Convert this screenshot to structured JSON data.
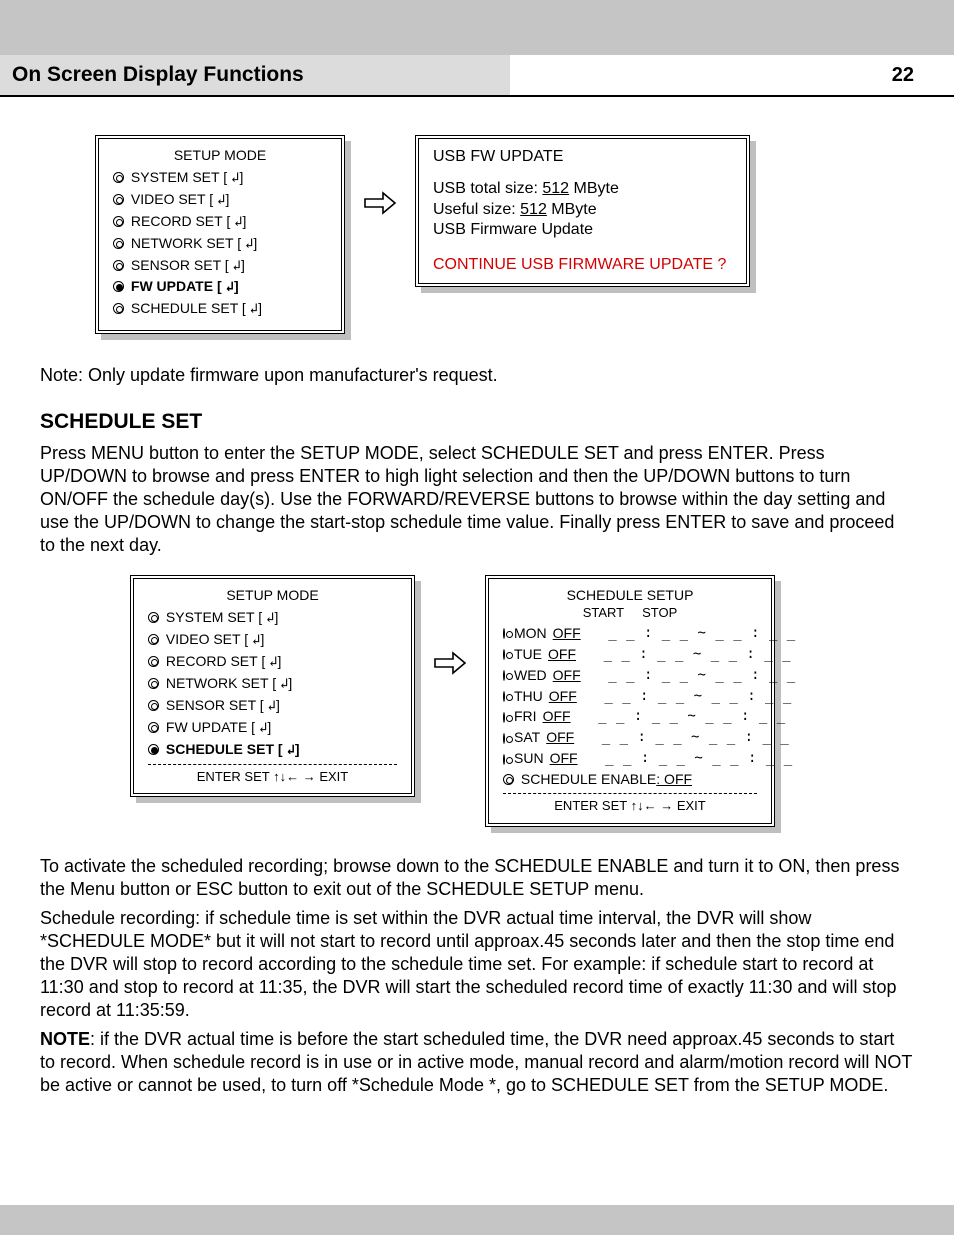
{
  "header": {
    "title": "On Screen Display Functions",
    "page": "22"
  },
  "setupMode1": {
    "title": "SETUP MODE",
    "items": [
      {
        "label": "SYSTEM SET",
        "bold": false
      },
      {
        "label": "VIDEO SET",
        "bold": false
      },
      {
        "label": "RECORD SET",
        "bold": false
      },
      {
        "label": "NETWORK SET",
        "bold": false
      },
      {
        "label": "SENSOR SET",
        "bold": false
      },
      {
        "label": "FW UPDATE",
        "bold": true
      },
      {
        "label": "SCHEDULE SET",
        "bold": false
      }
    ]
  },
  "usbBox": {
    "title": "USB FW UPDATE",
    "line1a": "USB total size: ",
    "line1b": "512",
    "line1c": " MByte",
    "line2a": "Useful size: ",
    "line2b": "512",
    "line2c": " MByte",
    "line3": "USB Firmware Update",
    "prompt": "CONTINUE USB FIRMWARE UPDATE ?"
  },
  "note1": "Note: Only update firmware upon manufacturer's request.",
  "scheduleHeading": "SCHEDULE SET",
  "schedulePara": "Press MENU button to enter the SETUP MODE, select SCHEDULE SET and press ENTER. Press UP/DOWN to browse and press ENTER to high light selection and then the UP/DOWN buttons to turn ON/OFF the schedule day(s). Use the FORWARD/REVERSE buttons to browse within the day setting and use the UP/DOWN to change the start-stop schedule time value. Finally press ENTER to save and proceed to the next day.",
  "setupMode2": {
    "title": "SETUP MODE",
    "items": [
      {
        "label": "SYSTEM SET",
        "bold": false
      },
      {
        "label": "VIDEO SET",
        "bold": false
      },
      {
        "label": "RECORD SET",
        "bold": false
      },
      {
        "label": "NETWORK SET",
        "bold": false
      },
      {
        "label": "SENSOR SET",
        "bold": false
      },
      {
        "label": "FW UPDATE",
        "bold": false
      },
      {
        "label": "SCHEDULE SET",
        "bold": true
      }
    ],
    "footer": "ENTER SET ↑↓← → EXIT"
  },
  "scheduleBox": {
    "title": "SCHEDULE SETUP",
    "colStart": "START",
    "colStop": "STOP",
    "days": [
      {
        "day": "MON",
        "state": "OFF"
      },
      {
        "day": "TUE",
        "state": "OFF"
      },
      {
        "day": "WED",
        "state": "OFF"
      },
      {
        "day": "THU",
        "state": "OFF"
      },
      {
        "day": "FRI",
        "state": "OFF"
      },
      {
        "day": "SAT",
        "state": "OFF"
      },
      {
        "day": "SUN",
        "state": "OFF"
      }
    ],
    "timeTemplate": "_ _ : _ _ ~ _ _ : _ _",
    "enableLabel": "SCHEDULE ENABLE",
    "enableValue": ": OFF",
    "footer": "ENTER SET ↑↓← → EXIT"
  },
  "para2": "To activate the scheduled recording; browse down to the SCHEDULE ENABLE and turn it to ON, then press the Menu button or ESC button to exit out of the SCHEDULE SETUP menu.",
  "para3": "Schedule recording: if schedule time is set within the DVR actual time interval, the DVR will show *SCHEDULE MODE* but it will not start to record until approax.45 seconds later and then the stop time end the DVR will stop to record according to the schedule time set. For example: if schedule start to record at 11:30 and stop to record at 11:35, the DVR will start the scheduled record time of exactly 11:30 and will stop record at 11:35:59.",
  "noteLabel": "NOTE",
  "para4": ": if the DVR actual time is before the start scheduled time, the DVR need approax.45 seconds to start to record. When schedule record is in use or in active mode, manual record and alarm/motion record will NOT be active or cannot be used, to turn off *Schedule Mode *, go to SCHEDULE SET from the SETUP MODE.",
  "enterSymbol": "↲"
}
